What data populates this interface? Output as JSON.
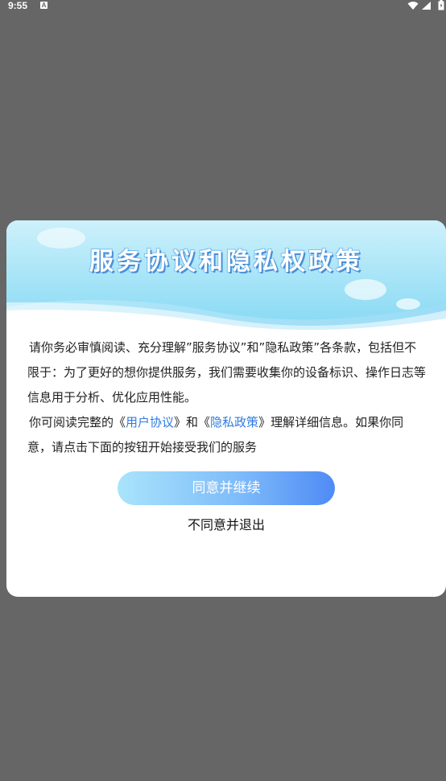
{
  "status_bar": {
    "time": "9:55",
    "notification_icon_letter": "A",
    "icons": [
      "wifi-icon",
      "signal-icon",
      "battery-icon"
    ]
  },
  "dialog": {
    "title": "服务协议和隐私权政策",
    "paragraph1": "请你务必审慎阅读、充分理解”服务协议”和”隐私政策”各条款，包括但不限于：为了更好的想你提供服务，我们需要收集你的设备标识、操作日志等信息用于分析、优化应用性能。",
    "paragraph2_pre": "你可阅读完整的《",
    "user_agreement_link": "用户协议",
    "paragraph2_mid": "》和《",
    "privacy_policy_link": "隐私政策",
    "paragraph2_post": "》理解详细信息。如果你同意，请点击下面的按钮开始接受我们的服务",
    "agree_button": "同意并继续",
    "disagree_button": "不同意并退出"
  },
  "colors": {
    "backdrop": "#666666",
    "link": "#2f7be0",
    "button_gradient_start": "#a9e4fb",
    "button_gradient_end": "#4f8bf5"
  }
}
